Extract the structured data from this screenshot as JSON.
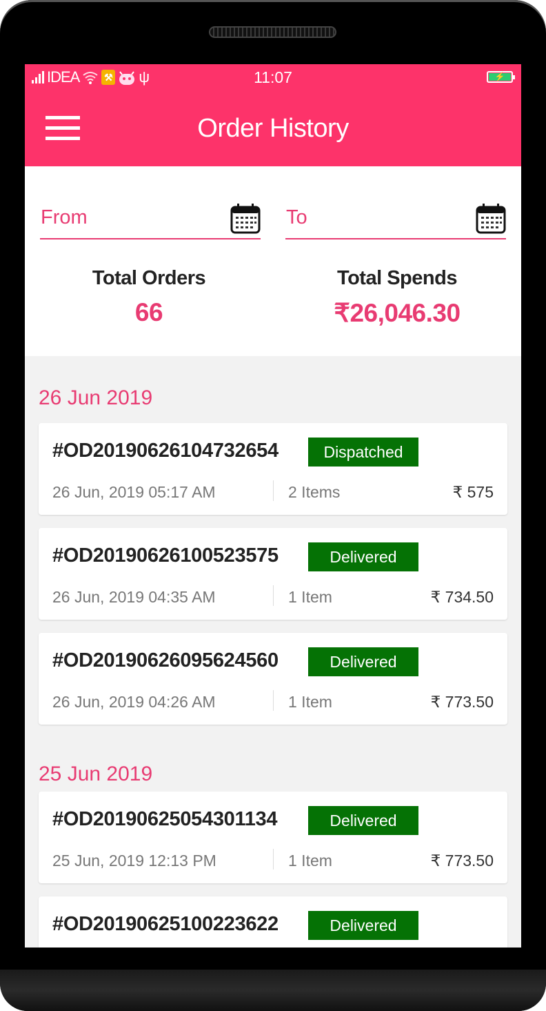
{
  "status_bar": {
    "carrier": "IDEA",
    "time": "11:07",
    "icons": [
      "signal-icon",
      "wifi-icon",
      "tool-icon",
      "android-icon",
      "usb-icon",
      "battery-charging-icon"
    ]
  },
  "app_bar": {
    "title": "Order History",
    "menu_icon": "hamburger-menu-icon"
  },
  "filters": {
    "from_label": "From",
    "to_label": "To",
    "icon": "calendar-icon"
  },
  "summary": {
    "orders_label": "Total Orders",
    "orders_value": "66",
    "spends_label": "Total Spends",
    "spends_value": "₹26,046.30"
  },
  "colors": {
    "brand": "#fd336a",
    "accent_text": "#e83b72",
    "status_green": "#057205",
    "background": "#f2f2f2"
  },
  "groups": [
    {
      "date": "26 Jun 2019",
      "orders": [
        {
          "id": "#OD20190626104732654",
          "status": "Dispatched",
          "datetime": "26 Jun, 2019 05:17 AM",
          "items": "2 Items",
          "amount": "₹ 575"
        },
        {
          "id": "#OD20190626100523575",
          "status": "Delivered",
          "datetime": "26 Jun, 2019 04:35 AM",
          "items": "1 Item",
          "amount": "₹ 734.50"
        },
        {
          "id": "#OD20190626095624560",
          "status": "Delivered",
          "datetime": "26 Jun, 2019 04:26 AM",
          "items": "1 Item",
          "amount": "₹ 773.50"
        }
      ]
    },
    {
      "date": "25 Jun 2019",
      "orders": [
        {
          "id": "#OD20190625054301134",
          "status": "Delivered",
          "datetime": "25 Jun, 2019 12:13 PM",
          "items": "1 Item",
          "amount": "₹ 773.50"
        },
        {
          "id": "#OD20190625100223622",
          "status": "Delivered",
          "datetime": "",
          "items": "",
          "amount": ""
        }
      ]
    }
  ]
}
